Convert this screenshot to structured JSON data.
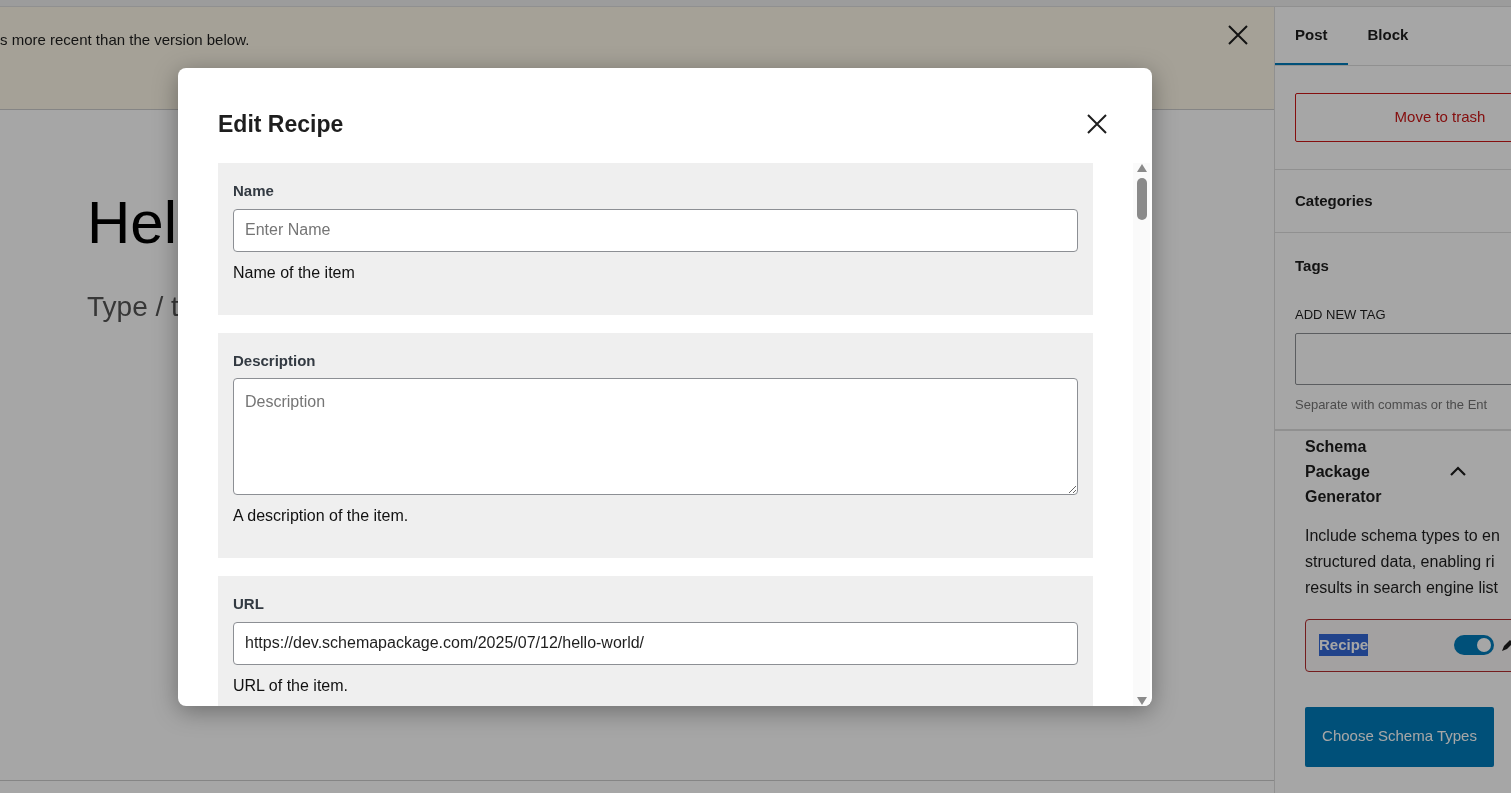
{
  "notice": {
    "text": "s more recent than the version below."
  },
  "editor": {
    "title": "Hel",
    "placeholder": "Type / t"
  },
  "sidebar": {
    "tabs": [
      {
        "label": "Post",
        "selected": true
      },
      {
        "label": "Block",
        "selected": false
      }
    ],
    "trash_button": "Move to trash",
    "categories": "Categories",
    "tags": {
      "title": "Tags",
      "label": "ADD NEW TAG",
      "help": "Separate with commas or the Ent"
    },
    "schema_panel": {
      "title": "Schema Package Generator",
      "expanded": true,
      "description": [
        "Include schema types to en",
        "structured data, enabling ri",
        "results in search engine list"
      ],
      "types": [
        {
          "label": "Recipe",
          "on": true
        }
      ],
      "button": "Choose Schema Types"
    }
  },
  "modal": {
    "title": "Edit Recipe",
    "fields": [
      {
        "label": "Name",
        "kind": "input",
        "placeholder": "Enter Name",
        "help": "Name of the item"
      },
      {
        "label": "Description",
        "kind": "textarea",
        "placeholder": "Description",
        "help": "A description of the item."
      },
      {
        "label": "URL",
        "kind": "input",
        "value": "https://dev.schemapackage.com/2025/07/12/hello-world/",
        "help": "URL of the item."
      }
    ]
  }
}
